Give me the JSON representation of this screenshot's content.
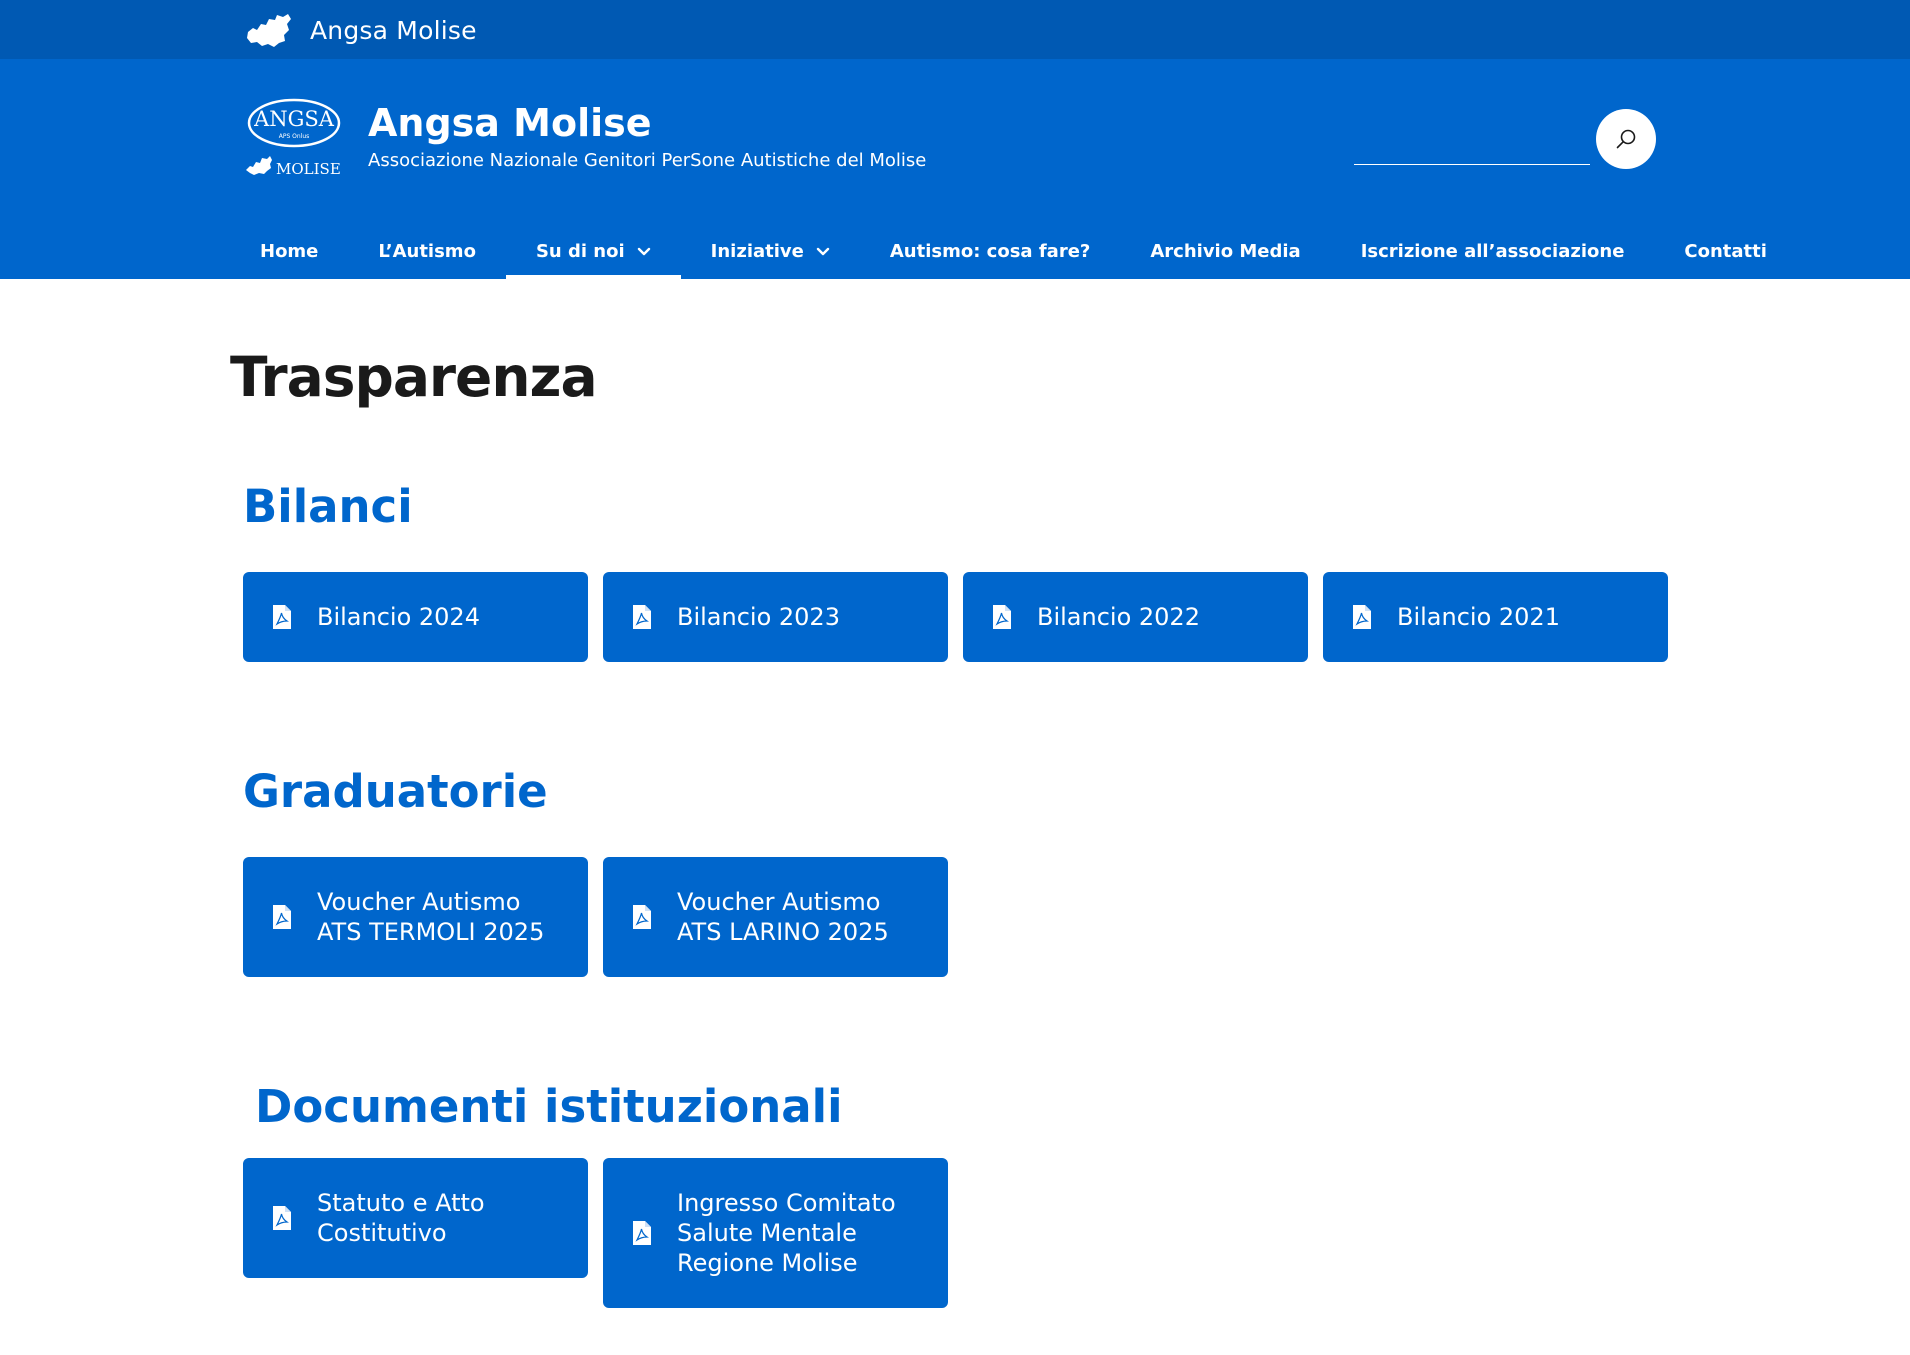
{
  "topbar": {
    "title": "Angsa Molise"
  },
  "header": {
    "logo_text_top": "ANGSA",
    "logo_text_small": "APS Onlus",
    "logo_text_bottom": "MOLISE",
    "title": "Angsa Molise",
    "subtitle": "Associazione Nazionale Genitori PerSone Autistiche del Molise",
    "search_placeholder": ""
  },
  "nav": {
    "items": [
      {
        "label": "Home"
      },
      {
        "label": "L’Autismo"
      },
      {
        "label": "Su di noi"
      },
      {
        "label": "Iniziative"
      },
      {
        "label": "Autismo: cosa fare?"
      },
      {
        "label": "Archivio Media"
      },
      {
        "label": "Iscrizione all’associazione"
      },
      {
        "label": "Contatti"
      }
    ]
  },
  "page": {
    "title": "Trasparenza"
  },
  "sections": {
    "bilanci": {
      "title": "Bilanci",
      "docs": [
        "Bilancio 2024",
        "Bilancio 2023",
        "Bilancio 2022",
        "Bilancio 2021"
      ]
    },
    "graduatorie": {
      "title": "Graduatorie",
      "docs": [
        "Voucher Autismo ATS TERMOLI 2025",
        "Voucher Autismo ATS LARINO 2025"
      ]
    },
    "documenti": {
      "title": "Documenti istituzionali",
      "docs": [
        "Statuto e Atto Costitutivo",
        "Ingresso Comitato Salute Mentale Regione Molise"
      ]
    }
  },
  "colors": {
    "primary": "#0066cc",
    "topbar": "#0059b3",
    "text": "#1a1a1a"
  }
}
